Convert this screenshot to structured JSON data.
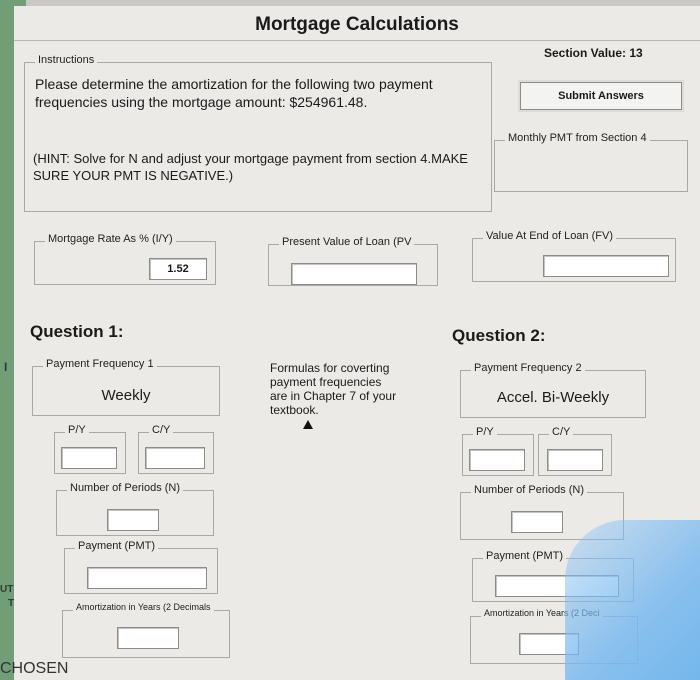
{
  "window": {
    "title": "Mortgage Calculations"
  },
  "outside": {
    "left_text_1": "UTS",
    "left_text_2": "T",
    "bottom_text": "CHOSEN",
    "left_mark": "I"
  },
  "header": {
    "section_value": "Section Value: 13",
    "submit_label": "Submit Answers"
  },
  "instructions": {
    "label": "Instructions",
    "text": "Please determine the amortization for the following two payment frequencies using the mortgage amount: $254961.48.",
    "hint": "(HINT: Solve for N and adjust your mortgage payment from section 4.MAKE SURE YOUR PMT IS NEGATIVE.)"
  },
  "monthly_pmt": {
    "label": "Monthly PMT from Section 4"
  },
  "rate": {
    "label": "Mortgage Rate As % (I/Y)",
    "value": "1.52"
  },
  "pv": {
    "label": "Present Value of Loan (PV",
    "value": ""
  },
  "fv": {
    "label": "Value At End of Loan (FV)",
    "value": ""
  },
  "note": "Formulas for coverting payment frequencies are in Chapter 7 of your textbook.",
  "q1": {
    "title": "Question 1:",
    "freq_label": "Payment Frequency 1",
    "freq_value": "Weekly",
    "py_label": "P/Y",
    "py_value": "",
    "cy_label": "C/Y",
    "cy_value": "",
    "n_label": "Number of Periods (N)",
    "n_value": "",
    "pmt_label": "Payment (PMT)",
    "pmt_value": "",
    "amort_label": "Amortization in Years (2 Decimals",
    "amort_value": ""
  },
  "q2": {
    "title": "Question 2:",
    "freq_label": "Payment Frequency 2",
    "freq_value": "Accel. Bi-Weekly",
    "py_label": "P/Y",
    "py_value": "",
    "cy_label": "C/Y",
    "cy_value": "",
    "n_label": "Number of Periods (N)",
    "n_value": "",
    "pmt_label": "Payment (PMT)",
    "pmt_value": "",
    "amort_label": "Amortization in Years (2 Deci",
    "amort_value": ""
  }
}
